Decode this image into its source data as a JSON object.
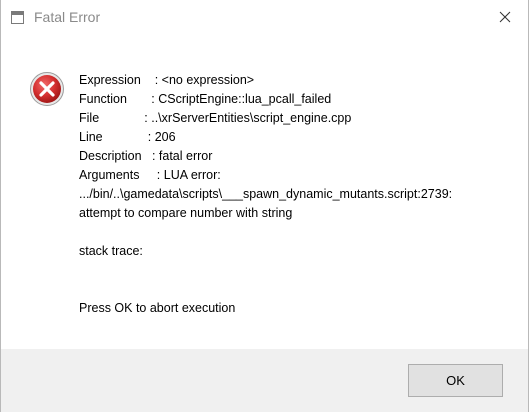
{
  "window": {
    "title": "Fatal Error",
    "icon": "application-window-icon",
    "close_icon": "close-icon"
  },
  "message": {
    "icon": "error-icon",
    "lines": [
      "Expression    : <no expression>",
      "Function       : CScriptEngine::lua_pcall_failed",
      "File             : ..\\xrServerEntities\\script_engine.cpp",
      "Line             : 206",
      "Description   : fatal error",
      "Arguments     : LUA error:",
      ".../bin/..\\gamedata\\scripts\\___spawn_dynamic_mutants.script:2739:",
      "attempt to compare number with string"
    ],
    "stack_trace": "stack trace:",
    "prompt": "Press OK to abort execution"
  },
  "buttons": {
    "ok_label": "OK"
  },
  "colors": {
    "error_red": "#d32f2f",
    "footer_bg": "#f0f0f0"
  }
}
